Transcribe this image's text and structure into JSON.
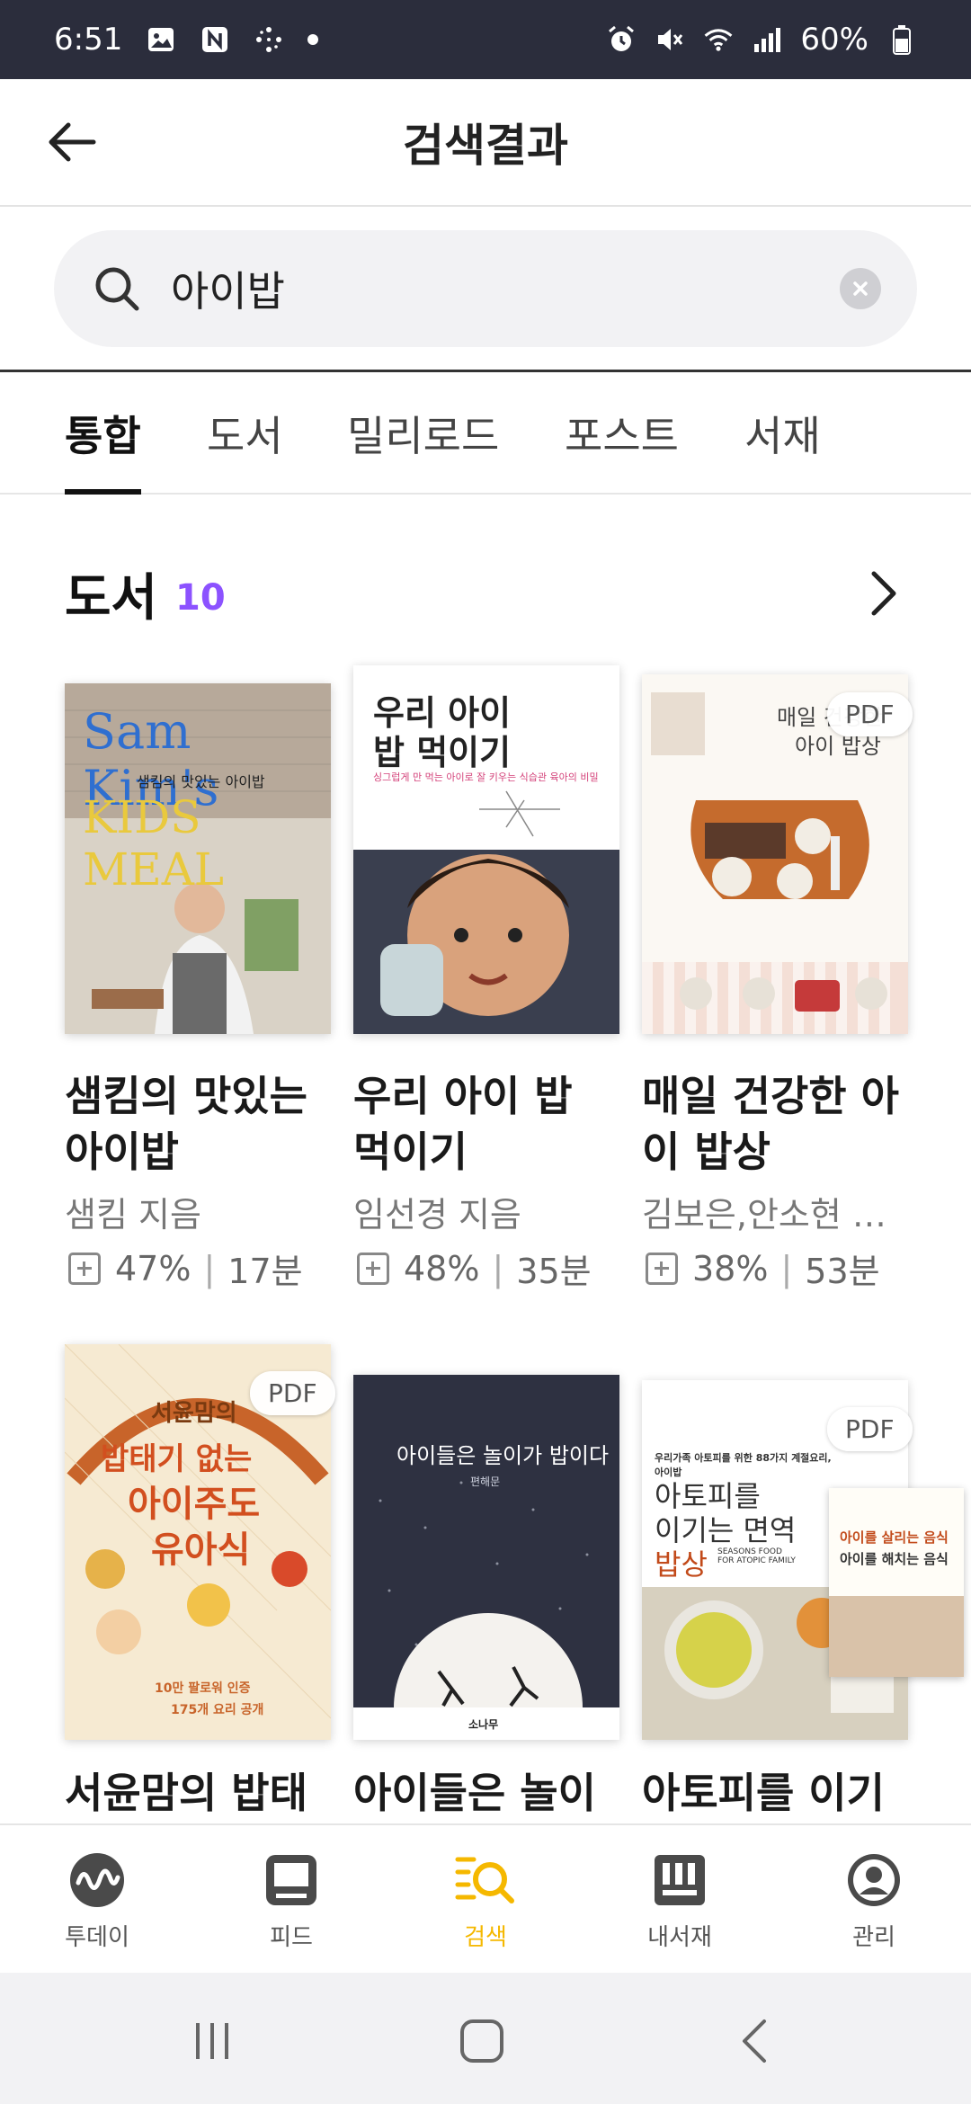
{
  "status": {
    "time": "6:51",
    "battery": "60%",
    "icons_left": [
      "gallery-icon",
      "n-notification-icon",
      "sparkle-icon",
      "dot-icon"
    ],
    "icons_right": [
      "alarm-icon",
      "mute-icon",
      "wifi-icon",
      "signal-icon",
      "battery-icon"
    ]
  },
  "header": {
    "title": "검색결과",
    "back_icon": "back-arrow-icon"
  },
  "search": {
    "query": "아이밥",
    "search_icon": "search-icon",
    "clear_icon": "clear-icon"
  },
  "tabs": [
    {
      "label": "통합",
      "active": true
    },
    {
      "label": "도서",
      "active": false
    },
    {
      "label": "밀리로드",
      "active": false
    },
    {
      "label": "포스트",
      "active": false
    },
    {
      "label": "서재",
      "active": false
    }
  ],
  "section": {
    "title": "도서",
    "count": "10",
    "more_icon": "chevron-right-icon"
  },
  "books": [
    {
      "title": "샘킴의 맛있는 아이밥",
      "author": "샘킴 지음",
      "progress": "47%",
      "time": "17분",
      "pdf": "",
      "cover_text": [
        "Sam Kim's",
        "샘킴의 맛있는 아이밥",
        "KIDS MEAL"
      ]
    },
    {
      "title": "우리 아이 밥 먹이기",
      "author": "임선경 지음",
      "progress": "48%",
      "time": "35분",
      "pdf": "",
      "cover_text": [
        "우리 아이",
        "밥 먹이기",
        "싱그럽게 만 먹는 아이로 잘 키우는 식습관 육아의 비밀"
      ]
    },
    {
      "title": "매일 건강한 아이 밥상",
      "author": "김보은,안소현 …",
      "progress": "38%",
      "time": "53분",
      "pdf": "PDF",
      "cover_text": [
        "매일 건강한",
        "아이 밥상"
      ]
    },
    {
      "title": "서윤맘의 밥태기 없는 아이주도 유아식",
      "author": "",
      "progress": "",
      "time": "",
      "pdf": "PDF",
      "cover_text": [
        "서윤맘의",
        "밥태기 없는",
        "아이주도",
        "유아식",
        "10만 팔로워 인증",
        "175개 요리 공개"
      ]
    },
    {
      "title": "아이들은 놀이가 밥이다",
      "author": "",
      "progress": "",
      "time": "",
      "pdf": "",
      "cover_text": [
        "아이들은 놀이가 밥이다",
        "편해문",
        "소나무"
      ]
    },
    {
      "title": "아토피를 이기는 면역 밥상",
      "author": "",
      "progress": "",
      "time": "",
      "pdf": "PDF",
      "cover_text": [
        "우리가족 아토피를 위한 88가지 계절요리, 아이밥",
        "아토피를",
        "이기는 면역",
        "밥상",
        "SEASONS FOOD FOR ATOPIC FAMILY",
        "아이를 살리는 음식",
        "아이를 해치는 음식"
      ]
    }
  ],
  "row2_titles": [
    "서윤맘의 밥태",
    "아이들은 놀이",
    "아토피를 이기"
  ],
  "bottom_nav": [
    {
      "label": "투데이",
      "icon": "today-icon",
      "active": false
    },
    {
      "label": "피드",
      "icon": "feed-icon",
      "active": false
    },
    {
      "label": "검색",
      "icon": "search-list-icon",
      "active": true
    },
    {
      "label": "내서재",
      "icon": "library-icon",
      "active": false
    },
    {
      "label": "관리",
      "icon": "profile-icon",
      "active": false
    }
  ],
  "colors": {
    "accent": "#8c52ff",
    "nav_active": "#f5b800",
    "status_bar": "#2b2d3c"
  }
}
